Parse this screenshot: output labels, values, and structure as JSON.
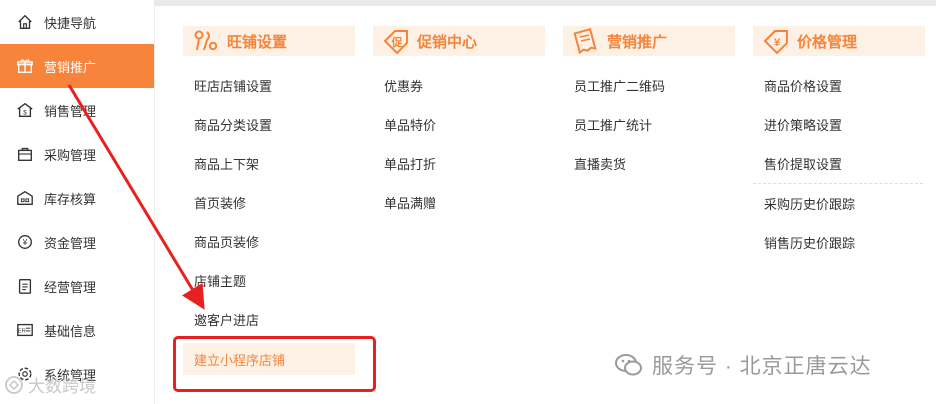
{
  "sidebar": {
    "items": [
      {
        "label": "快捷导航",
        "icon": "home-icon"
      },
      {
        "label": "营销推广",
        "icon": "gift-icon",
        "active": true
      },
      {
        "label": "销售管理",
        "icon": "money-house-icon"
      },
      {
        "label": "采购管理",
        "icon": "shopping-bag-icon"
      },
      {
        "label": "库存核算",
        "icon": "warehouse-icon"
      },
      {
        "label": "资金管理",
        "icon": "yen-coin-icon"
      },
      {
        "label": "经营管理",
        "icon": "clipboard-icon"
      },
      {
        "label": "基础信息",
        "icon": "id-card-icon"
      },
      {
        "label": "系统管理",
        "icon": "settings-icon"
      }
    ]
  },
  "menu": {
    "columns": [
      {
        "title": "旺铺设置",
        "icon": "tools-icon",
        "items": [
          "旺店店铺设置",
          "商品分类设置",
          "商品上下架",
          "首页装修",
          "商品页装修",
          "店铺主题",
          "邀客户进店",
          "建立小程序店铺"
        ]
      },
      {
        "title": "促销中心",
        "icon": "promotion-tag-icon",
        "items": [
          "优惠券",
          "单品特价",
          "单品打折",
          "单品满赠"
        ]
      },
      {
        "title": "营销推广",
        "icon": "receipt-icon",
        "items": [
          "员工推广二维码",
          "员工推广统计",
          "直播卖货"
        ]
      },
      {
        "title": "价格管理",
        "icon": "price-tag-icon",
        "items": [
          "商品价格设置",
          "进价策略设置",
          "售价提取设置",
          "采购历史价跟踪",
          "销售历史价跟踪"
        ]
      }
    ]
  },
  "watermark": {
    "text": "服务号 · 北京正唐云达"
  },
  "watermark2": {
    "text": "大数跨境"
  },
  "colors": {
    "accent": "#f7843a",
    "header_bg": "#fdf1e6",
    "annotation_red": "#e82020"
  }
}
